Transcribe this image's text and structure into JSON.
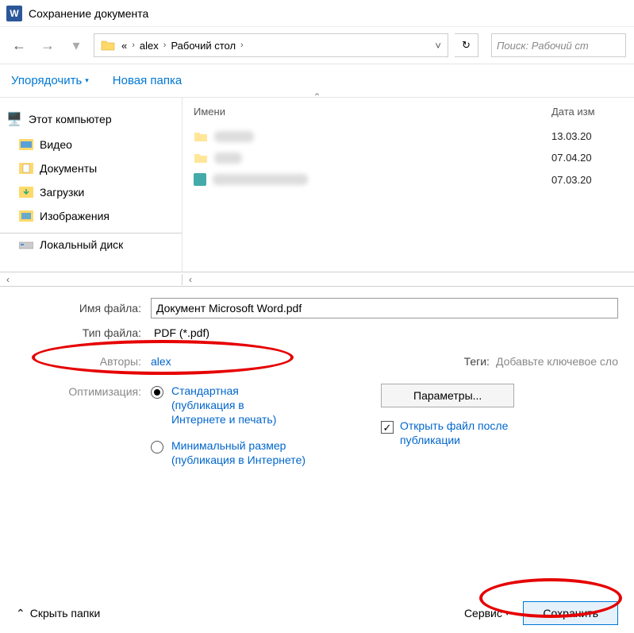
{
  "title": "Сохранение документа",
  "breadcrumb": {
    "items": [
      "«",
      "alex",
      "Рабочий стол"
    ],
    "search_placeholder": "Поиск: Рабочий ст"
  },
  "toolbar": {
    "organize": "Упорядочить",
    "new_folder": "Новая папка"
  },
  "sidebar": {
    "this_pc": "Этот компьютер",
    "videos": "Видео",
    "documents": "Документы",
    "downloads": "Загрузки",
    "pictures": "Изображения",
    "local_disk": "Локальный диск"
  },
  "file_list": {
    "col_name": "Имени",
    "col_date": "Дата изм",
    "rows": [
      {
        "date": "13.03.20"
      },
      {
        "date": "07.04.20"
      },
      {
        "date": "07.03.20"
      }
    ]
  },
  "form": {
    "filename_label": "Имя файла:",
    "filename_value": "Документ Microsoft Word.pdf",
    "filetype_label": "Тип файла:",
    "filetype_value": "PDF (*.pdf)",
    "authors_label": "Авторы:",
    "authors_value": "alex",
    "tags_label": "Теги:",
    "tags_hint": "Добавьте ключевое сло"
  },
  "options": {
    "optimization_label": "Оптимизация:",
    "opt_standard": "Стандартная (публикация в Интернете и печать)",
    "opt_minimal": "Минимальный размер (публикация в Интернете)",
    "params_button": "Параметры...",
    "open_after": "Открыть файл после публикации"
  },
  "footer": {
    "hide_folders": "Скрыть папки",
    "service": "Сервис",
    "save": "Сохранить"
  }
}
